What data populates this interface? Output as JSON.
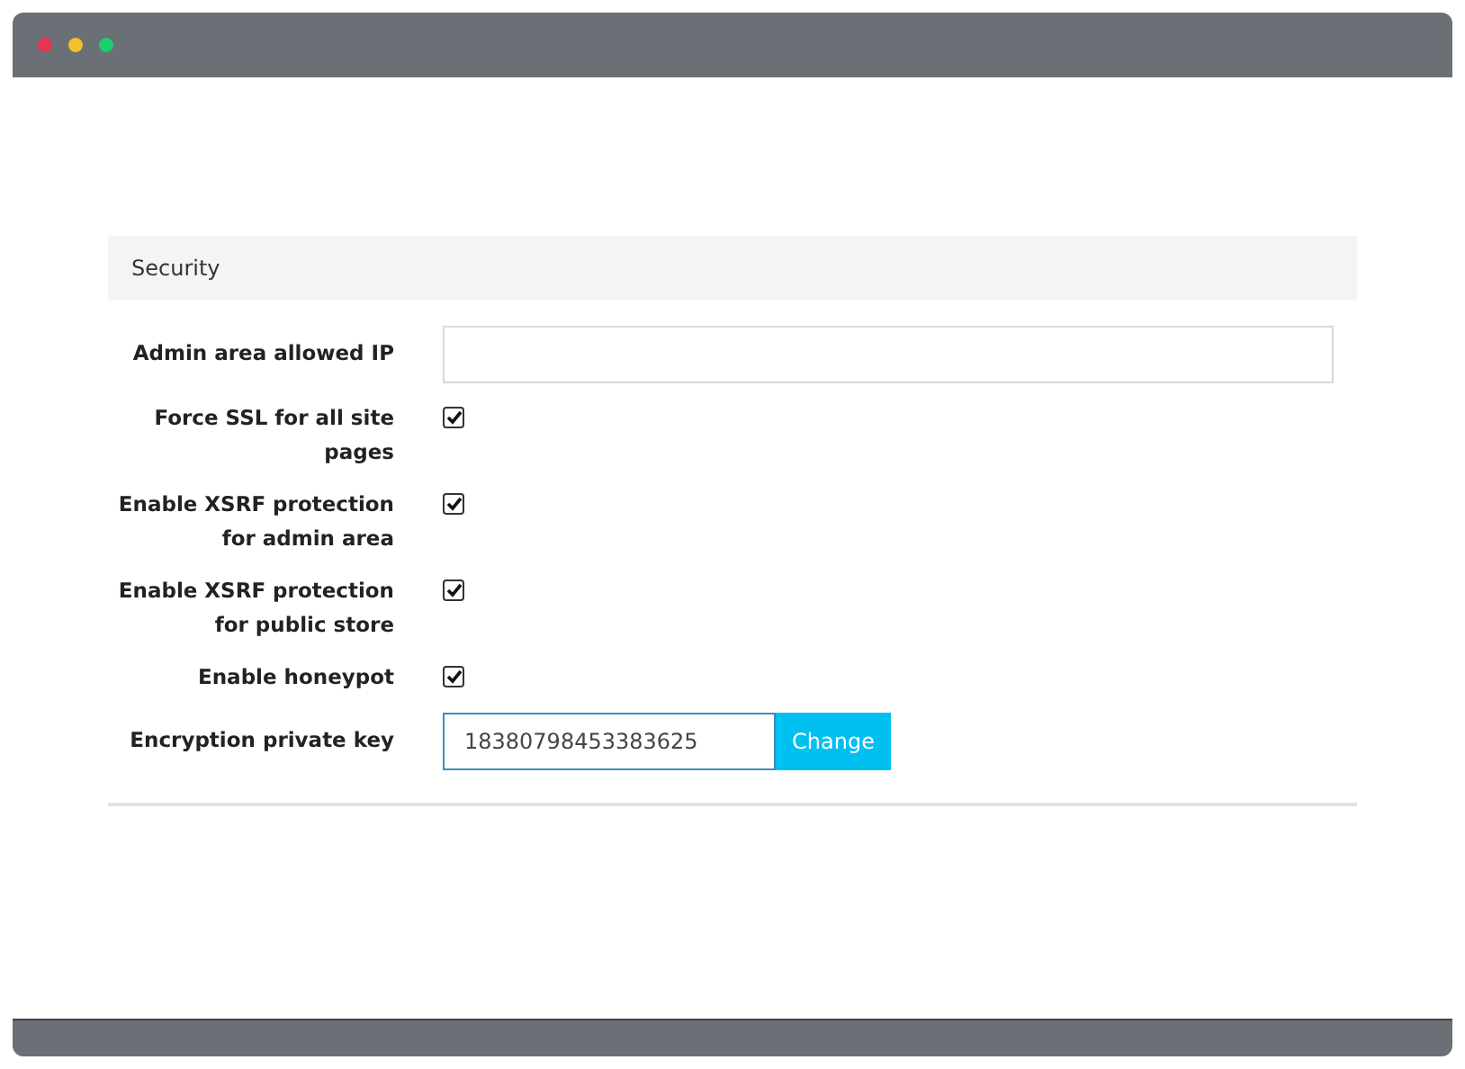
{
  "panel": {
    "title": "Security"
  },
  "fields": [
    {
      "kind": "text",
      "label": "Admin area allowed IP"
    },
    {
      "kind": "checkbox",
      "label": "Force SSL for all site pages",
      "checked": true
    },
    {
      "kind": "checkbox",
      "label": "Enable XSRF protection for admin area",
      "checked": true
    },
    {
      "kind": "checkbox",
      "label": "Enable XSRF protection for public store",
      "checked": true
    },
    {
      "kind": "checkbox",
      "label": "Enable honeypot",
      "checked": true
    },
    {
      "kind": "key",
      "label": "Encryption private key",
      "value": "18380798453383625",
      "button": "Change"
    }
  ]
}
